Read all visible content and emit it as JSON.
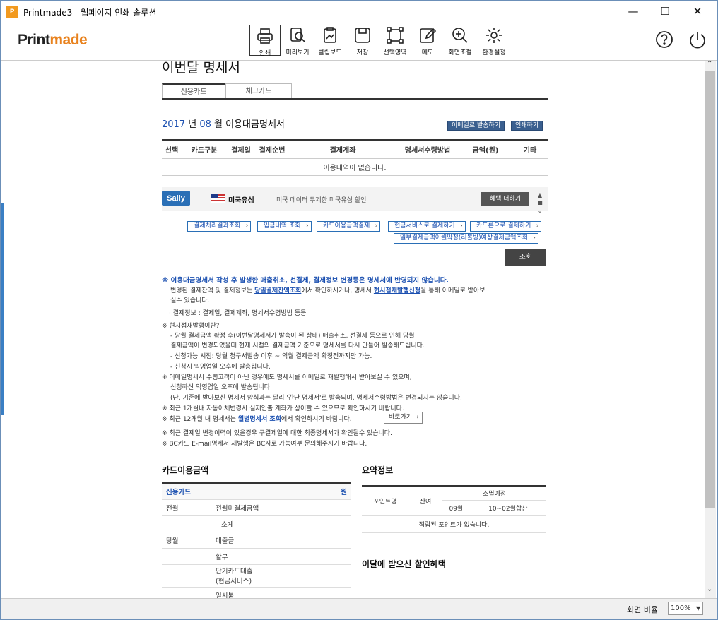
{
  "window": {
    "title": "Printmade3 - 웹페이지 인쇄 솔루션",
    "controls": [
      "—",
      "☐",
      "✕"
    ]
  },
  "toolbar": {
    "logo_a": "Print",
    "logo_b": "made",
    "buttons": [
      "인쇄",
      "미리보기",
      "클립보드",
      "저장",
      "선택영역",
      "메모",
      "화면조절",
      "환경설정"
    ],
    "help": "?",
    "power": "⏻"
  },
  "page": {
    "heading": "이번달 명세서",
    "tabs": [
      "신용카드",
      "체크카드"
    ],
    "stmt_year": "2017",
    "stmt_year_u": " 년 ",
    "stmt_month": "08",
    "stmt_month_u": " 월  ",
    "stmt_label": "이용대금명세서",
    "stmt_buttons": [
      "이메일로 발송하기",
      "인쇄하기"
    ],
    "table_headers": [
      "선택",
      "카드구분",
      "결제일",
      "결제순번",
      "결제계좌",
      "명세서수령방법",
      "금액(원)",
      "기타"
    ],
    "table_empty": "이용내역이 없습니다.",
    "banner": {
      "logo": "Sally",
      "name": "미국유심",
      "desc": "미국 데이터 무제한 미국유심 할인",
      "button": "혜택 더하기",
      "arrows": [
        "▲",
        "■",
        "⌄"
      ]
    },
    "links_row1": [
      "결제처리결과조회",
      "입금내역 조회",
      "카드이용금액결제",
      "현금서비스로 결제하기",
      "카드론으로 결제하기"
    ],
    "links_row2": [
      "일부결제금액이월약정(리볼빙)예상결제금액조회"
    ],
    "search": "조회",
    "notes": {
      "n1": "※ 이용대금명세서 작성 후 발생한 매출취소, 선결제, 결제정보 변경등은 명세서에 반영되지 않습니다.",
      "n2a": "변경된 결제잔액 및 결제정보는 ",
      "n2b": "당일결제잔액조회",
      "n2c": "에서 확인하시거나, 명세서 ",
      "n2d": "현시점재발행신청",
      "n2e": "을 통해 이메일로 받아보",
      "n3": "실수 있습니다.",
      "n4": "· 결제정보 : 결제일, 결제계좌, 명세서수령방법 등등",
      "n5": "※ 현시점재발행이란?",
      "n6": "- 당월 결제금액 확정 후(이번달명세서가 발송이 된 상태) 매출취소, 선결제 등으로 인해 당월",
      "n7": "결제금액이 변경되었을때 현재 시점의 결제금액 기준으로 명세서를 다시 만들어 발송해드립니다.",
      "n8": "- 신청가능 시점: 당월 청구서발송 이후 ~ 익월 결제금액 확정전까지만 가능.",
      "n9": "- 신청시 익영업일 오후에 발송됩니다.",
      "n10": "※ 이메일명세서 수령고객이 아닌 경우에도 명세서를 이메일로 재발행해서 받아보실 수 있으며,",
      "n11": "신청하신 익영업일 오후에 발송됩니다.",
      "n12": "(단, 기존에 받아보신 명세서 양식과는 달리 '간단 명세서'로 발송되며, 명세서수령방법은 변경되지는 않습니다.",
      "n13": "※ 최근 1개월내 자동이체변경시 실제인출 계좌가 상이할 수 있으므로 확인하시기 바랍니다.",
      "n14a": "※ 최근 12개월 내 명세서는 ",
      "n14b": "월별명세서 조회",
      "n14c": "에서 확인하시기 바랍니다.",
      "goto": "바로가기",
      "n15": "※ 최근 결제일 변경이력이 있을경우 구결제일에 대한 최종명세서가 확인될수 있습니다.",
      "n16": "※ BC카드 E-mail명세서 재발행은 BC사로 가능여부 문의해주시기 바랍니다."
    },
    "usage": {
      "title": "카드이용금액",
      "header": [
        "신용카드",
        "원"
      ],
      "rows": [
        [
          "전월",
          "전월미결제금액"
        ],
        [
          "",
          "소계"
        ],
        [
          "당월",
          "매출금"
        ],
        [
          "",
          "할부"
        ],
        [
          "",
          "단기카드대출\n(현금서비스)"
        ],
        [
          "",
          "일시불"
        ]
      ]
    },
    "summary": {
      "title": "요약정보",
      "h_point": "포인트명",
      "h_bal": "잔여",
      "h_exp": "소멸예정",
      "h_m1": "09월",
      "h_m2": "10~02월합산",
      "empty": "적립된 포인트가 없습니다."
    },
    "benefit_title": "이달에 받으신 할인혜택"
  },
  "status": {
    "zoom_label": "화면 비율",
    "zoom_value": "100%"
  }
}
